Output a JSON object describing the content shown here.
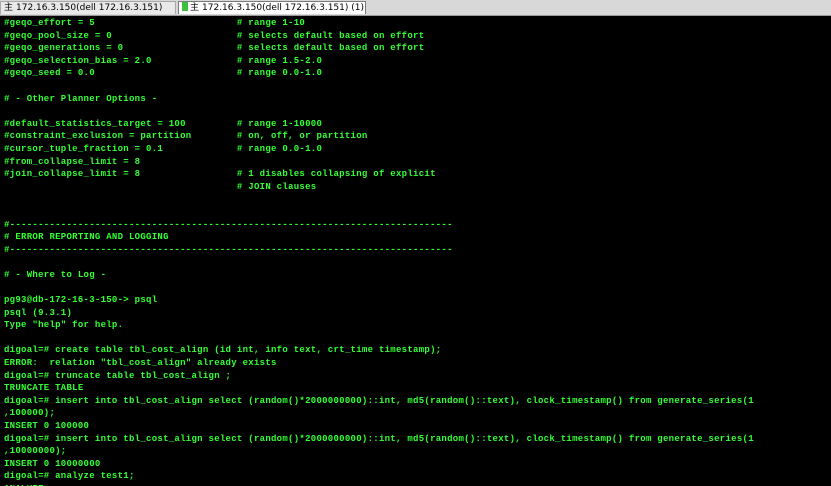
{
  "tabs": [
    {
      "glyph": "主",
      "label": "172.16.3.150(dell 172.16.3.151)"
    },
    {
      "glyph": "主",
      "label": "172.16.3.150(dell 172.16.3.151) (1)"
    }
  ],
  "colors": {
    "terminal_background": "#000000",
    "terminal_text": "#33ff33",
    "tab_bar": "#d8d8d8",
    "tab_indicator": "#3fbf3f"
  },
  "terminal": {
    "lines": [
      "#geqo_effort = 5                         # range 1-10",
      "#geqo_pool_size = 0                      # selects default based on effort",
      "#geqo_generations = 0                    # selects default based on effort",
      "#geqo_selection_bias = 2.0               # range 1.5-2.0",
      "#geqo_seed = 0.0                         # range 0.0-1.0",
      "",
      "# - Other Planner Options -",
      "",
      "#default_statistics_target = 100         # range 1-10000",
      "#constraint_exclusion = partition        # on, off, or partition",
      "#cursor_tuple_fraction = 0.1             # range 0.0-1.0",
      "#from_collapse_limit = 8",
      "#join_collapse_limit = 8                 # 1 disables collapsing of explicit",
      "                                         # JOIN clauses",
      "",
      "",
      "#------------------------------------------------------------------------------",
      "# ERROR REPORTING AND LOGGING",
      "#------------------------------------------------------------------------------",
      "",
      "# - Where to Log -",
      "",
      "pg93@db-172-16-3-150-> psql",
      "psql (9.3.1)",
      "Type \"help\" for help.",
      "",
      "digoal=# create table tbl_cost_align (id int, info text, crt_time timestamp);",
      "ERROR:  relation \"tbl_cost_align\" already exists",
      "digoal=# truncate table tbl_cost_align ;",
      "TRUNCATE TABLE",
      "digoal=# insert into tbl_cost_align select (random()*2000000000)::int, md5(random()::text), clock_timestamp() from generate_series(1",
      ",100000);",
      "INSERT 0 100000",
      "digoal=# insert into tbl_cost_align select (random()*2000000000)::int, md5(random()::text), clock_timestamp() from generate_series(1",
      ",10000000);",
      "INSERT 0 10000000",
      "digoal=# analyze test1;",
      "ANALYZE"
    ]
  }
}
